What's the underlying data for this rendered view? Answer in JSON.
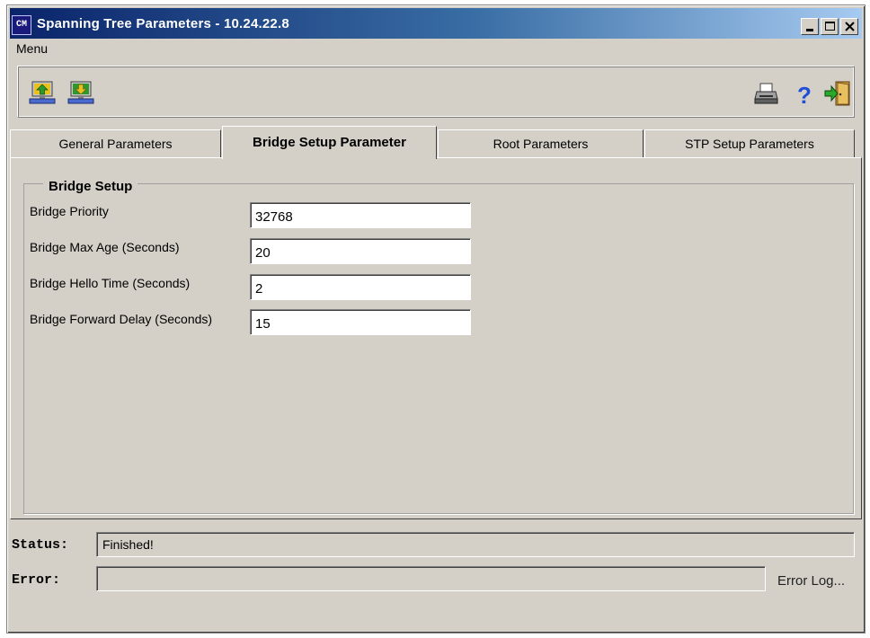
{
  "window": {
    "title": "Spanning Tree Parameters   - 10.24.22.8",
    "app_icon_text": "CM"
  },
  "menubar": {
    "menu_label": "Menu"
  },
  "toolbar": {
    "icons": [
      "upload-icon",
      "download-icon",
      "print-icon",
      "help-icon",
      "exit-icon"
    ]
  },
  "tabs": [
    {
      "label": "General Parameters",
      "active": false
    },
    {
      "label": "Bridge Setup Parameter",
      "active": true
    },
    {
      "label": "Root Parameters",
      "active": false
    },
    {
      "label": "STP Setup Parameters",
      "active": false
    }
  ],
  "bridge_setup": {
    "group_title": "Bridge Setup",
    "fields": [
      {
        "label": "Bridge Priority",
        "value": "32768"
      },
      {
        "label": "Bridge Max Age (Seconds)",
        "value": "20"
      },
      {
        "label": "Bridge Hello Time (Seconds)",
        "value": "2"
      },
      {
        "label": "Bridge Forward Delay (Seconds)",
        "value": "15"
      }
    ]
  },
  "status": {
    "status_label": "Status:",
    "status_value": "Finished!",
    "error_label": "Error:",
    "error_value": "",
    "error_log_label": "Error Log..."
  },
  "colors": {
    "window_bg": "#d4d0c8",
    "title_gradient_start": "#0a246a",
    "title_gradient_end": "#a6caf0",
    "help_blue": "#1f4fd8",
    "icon_green": "#2a9a2a",
    "icon_yellow": "#e8c020"
  }
}
